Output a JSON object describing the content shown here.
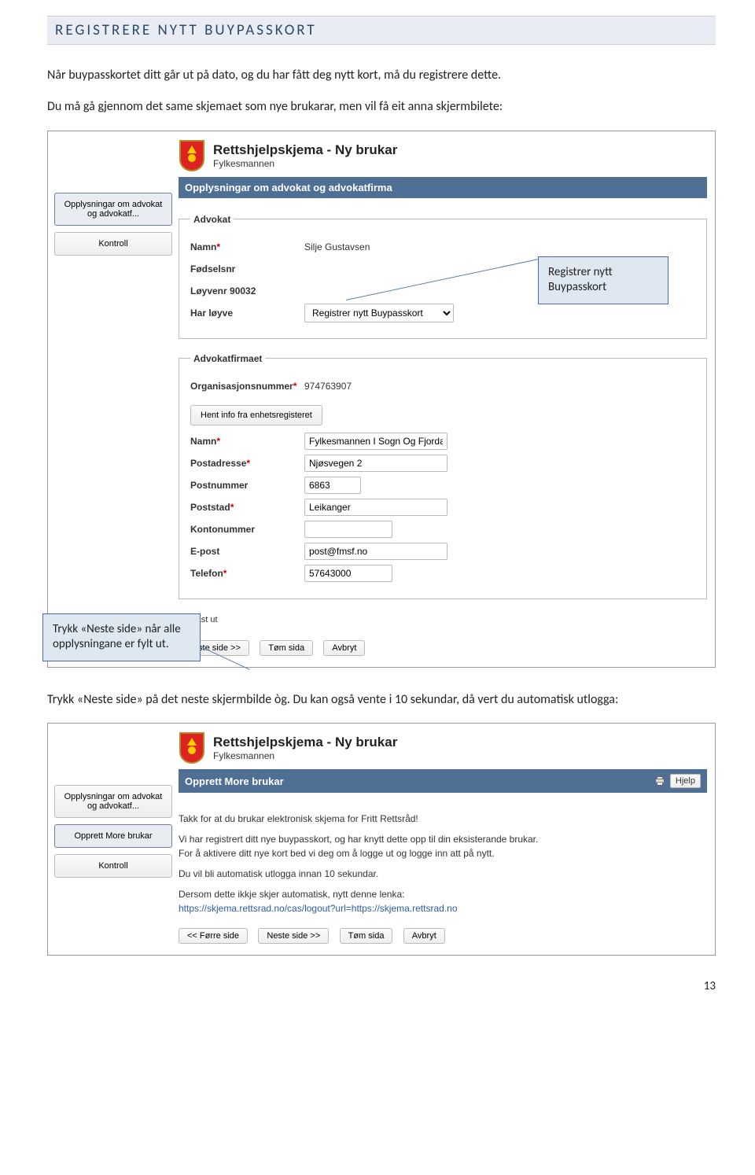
{
  "heading": "REGISTRERE NYTT BUYPASSKORT",
  "intro1": "Når buypasskortet ditt går ut på dato, og du har fått deg nytt kort, må du registrere dette.",
  "intro2": "Du må gå gjennom det same skjemaet som nye brukarar, men vil få eit anna skjermbilete:",
  "between": "Trykk «Neste side» på det neste skjermbilde òg. Du kan også vente i 10 sekundar, då vert du automatisk utlogga:",
  "app": {
    "title": "Rettshjelpskjema - Ny brukar",
    "sub": "Fylkesmannen",
    "nav_opplys": "Opplysningar om advokat og advokatf...",
    "nav_more": "Opprett More brukar",
    "nav_kontroll": "Kontroll",
    "bar1": "Opplysningar om advokat og advokatfirma",
    "bar2": "Opprett More brukar",
    "help": "Hjelp",
    "advokat_legend": "Advokat",
    "firma_legend": "Advokatfirmaet",
    "namn_label": "Namn",
    "namn_value": "Silje Gustavsen",
    "fodselsnr_label": "Fødselsnr",
    "loyvenr_label": "Løyvenr 90032",
    "harloyve_label": "Har løyve",
    "harloyve_value": "Registrer nytt Buypasskort",
    "orgnr_label": "Organisasjonsnummer",
    "orgnr_value": "974763907",
    "hent_btn": "Hent info fra enhetsregisteret",
    "firma_namn_value": "Fylkesmannen I Sogn Og Fjordar",
    "post_label": "Postadresse",
    "post_value": "Njøsvegen 2",
    "postnr_label": "Postnummer",
    "postnr_value": "6863",
    "poststad_label": "Poststad",
    "poststad_value": "Leikanger",
    "konto_label": "Kontonummer",
    "epost_label": "E-post",
    "epost_value": "post@fmsf.no",
    "tlf_label": "Telefon",
    "tlf_value": "57643000",
    "req_note": "å fyllast ut",
    "neste_btn": "Neste side >>",
    "forre_btn": "<< Førre side",
    "tom_btn": "Tøm sida",
    "avbryt_btn": "Avbryt"
  },
  "callout1": "Registrer nytt Buypasskort",
  "callout2": "Trykk «Neste side» når alle opplysningane er fylt ut.",
  "msg": {
    "p1": "Takk for at du brukar elektronisk skjema for Fritt Rettsråd!",
    "p2a": "Vi har registrert ditt nye buypasskort, og har knytt dette opp til din eksisterande brukar.",
    "p2b": "For å aktivere ditt nye kort bed vi deg om å logge ut og logge inn att på nytt.",
    "p3": "Du vil bli automatisk utlogga innan 10 sekundar.",
    "p4": "Dersom dette ikkje skjer automatisk, nytt denne lenka:",
    "link": "https://skjema.rettsrad.no/cas/logout?url=https://skjema.rettsrad.no"
  },
  "pagenum": "13"
}
